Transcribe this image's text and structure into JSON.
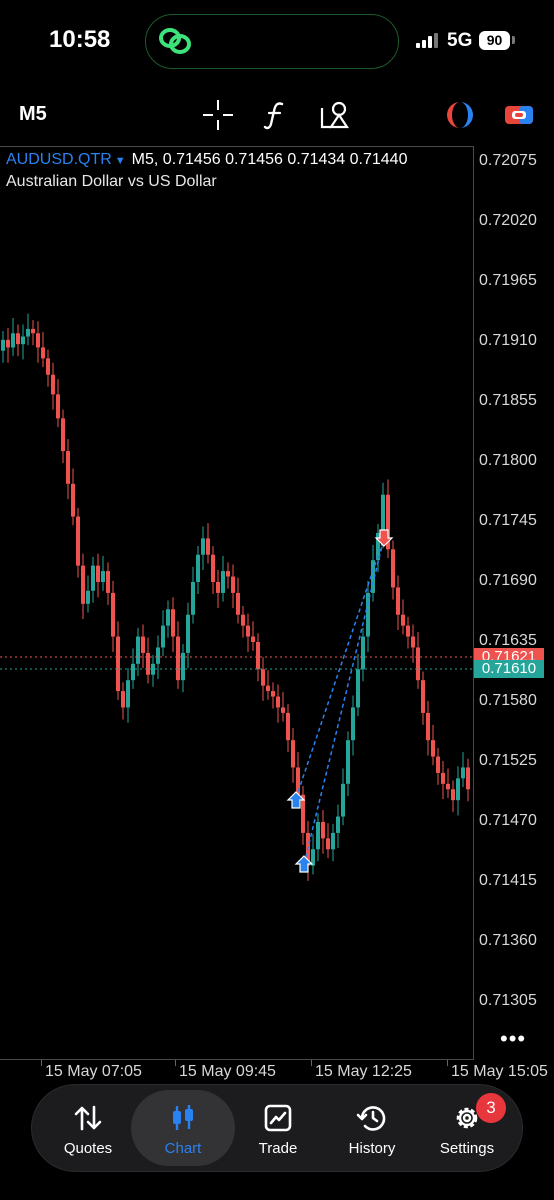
{
  "status": {
    "time": "10:58",
    "network": "5G",
    "battery": "90"
  },
  "toolbar": {
    "timeframe": "M5",
    "icons": [
      "crosshair-icon",
      "indicators-icon",
      "objects-icon",
      "trading-signals-icon",
      "one-click-trading-icon"
    ]
  },
  "chart": {
    "symbol": "AUDUSD.QTR",
    "ohlc_line": "M5, 0.71456 0.71456 0.71434 0.71440",
    "description": "Australian Dollar vs US Dollar",
    "price_labels": [
      "0.72075",
      "0.72020",
      "0.71965",
      "0.71910",
      "0.71855",
      "0.71800",
      "0.71745",
      "0.71690",
      "0.71635",
      "0.71580",
      "0.71525",
      "0.71470",
      "0.71415",
      "0.71360",
      "0.71305"
    ],
    "ask_price": "0.71621",
    "bid_price": "0.71610",
    "time_labels": [
      "15 May 07:05",
      "15 May 09:45",
      "15 May 12:25",
      "15 May 15:05"
    ],
    "more": "•••",
    "colors": {
      "bull": "#26a69a",
      "bear": "#ef5350",
      "ask": "#ef5350",
      "bid": "#26a69a",
      "trade_line": "#2a82f0"
    }
  },
  "chart_data": {
    "type": "candlestick",
    "symbol": "AUDUSD.QTR",
    "timeframe": "M5",
    "ylim": [
      0.7125,
      0.721
    ],
    "x": [
      "15 May 07:05",
      "15 May 09:45",
      "15 May 12:25",
      "15 May 15:05"
    ],
    "close": [
      0.71912,
      0.71905,
      0.71918,
      0.71908,
      0.71915,
      0.71922,
      0.71918,
      0.71905,
      0.71895,
      0.7188,
      0.71862,
      0.7184,
      0.7181,
      0.7178,
      0.7175,
      0.71705,
      0.7167,
      0.71682,
      0.71705,
      0.7169,
      0.717,
      0.7168,
      0.7164,
      0.7159,
      0.71575,
      0.716,
      0.71615,
      0.7164,
      0.71625,
      0.71605,
      0.71615,
      0.7163,
      0.7165,
      0.71665,
      0.7164,
      0.716,
      0.71625,
      0.7166,
      0.7169,
      0.71715,
      0.7173,
      0.71715,
      0.7169,
      0.7168,
      0.717,
      0.71695,
      0.7168,
      0.7166,
      0.7165,
      0.7164,
      0.71635,
      0.7161,
      0.71595,
      0.7159,
      0.71585,
      0.71575,
      0.7157,
      0.71545,
      0.7152,
      0.71495,
      0.7146,
      0.7143,
      0.71445,
      0.7147,
      0.71455,
      0.71445,
      0.7146,
      0.71475,
      0.71505,
      0.71545,
      0.71575,
      0.7161,
      0.7164,
      0.7168,
      0.7171,
      0.71735,
      0.7177,
      0.7172,
      0.71685,
      0.7166,
      0.7165,
      0.7164,
      0.7163,
      0.716,
      0.7157,
      0.71545,
      0.7153,
      0.71515,
      0.71505,
      0.715,
      0.7149,
      0.7151,
      0.7152,
      0.715
    ]
  },
  "tabs": [
    {
      "label": "Quotes",
      "icon": "quotes-arrows-icon"
    },
    {
      "label": "Chart",
      "icon": "candlestick-chart-icon"
    },
    {
      "label": "Trade",
      "icon": "trade-chart-icon"
    },
    {
      "label": "History",
      "icon": "history-clock-icon"
    },
    {
      "label": "Settings",
      "icon": "settings-gear-icon"
    }
  ],
  "settings_badge": "3"
}
